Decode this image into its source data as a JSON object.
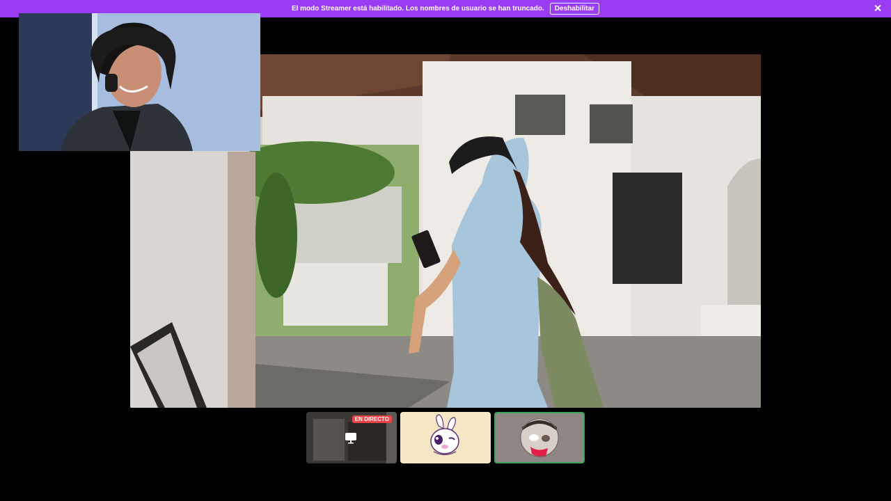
{
  "banner": {
    "message": "El modo Streamer está habilitado. Los nombres de usuario se han truncado.",
    "button_label": "Deshabilitar",
    "background_color": "#9b3cf5"
  },
  "tiles": {
    "stream": {
      "badge": "EN DIRECTO",
      "badge_color": "#ed4245",
      "icon": "screen-share-icon"
    },
    "avatar_bunny": {
      "icon": "bunny-avatar-icon"
    },
    "avatar_cat": {
      "icon": "cat-avatar-icon",
      "speaking_color": "#3ba55c"
    }
  },
  "icons": {
    "close": "close-icon"
  }
}
